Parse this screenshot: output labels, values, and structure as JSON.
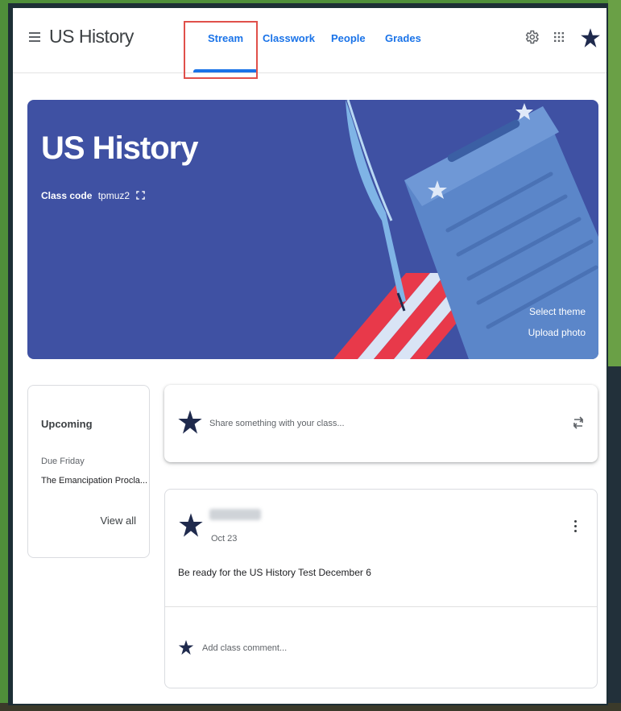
{
  "header": {
    "course_title": "US History",
    "tabs": [
      {
        "label": "Stream",
        "active": true
      },
      {
        "label": "Classwork",
        "active": false
      },
      {
        "label": "People",
        "active": false
      },
      {
        "label": "Grades",
        "active": false
      }
    ],
    "icons": [
      "menu-icon",
      "gear-icon",
      "apps-icon",
      "star-avatar-icon"
    ]
  },
  "banner": {
    "title": "US History",
    "class_code_label": "Class code",
    "class_code": "tpmuz2",
    "select_theme": "Select theme",
    "upload_photo": "Upload photo"
  },
  "upcoming": {
    "title": "Upcoming",
    "due_label": "Due Friday",
    "item": "The Emancipation Procla...",
    "view_all": "View all"
  },
  "share": {
    "placeholder": "Share something with your class..."
  },
  "post": {
    "date": "Oct 23",
    "text": "Be ready for the US History Test December 6",
    "comment_placeholder": "Add class comment..."
  },
  "colors": {
    "accent": "#1a73e8",
    "banner": "#3f51a3",
    "highlight": "#e0504a",
    "avatar_star": "#1f2a4d"
  }
}
